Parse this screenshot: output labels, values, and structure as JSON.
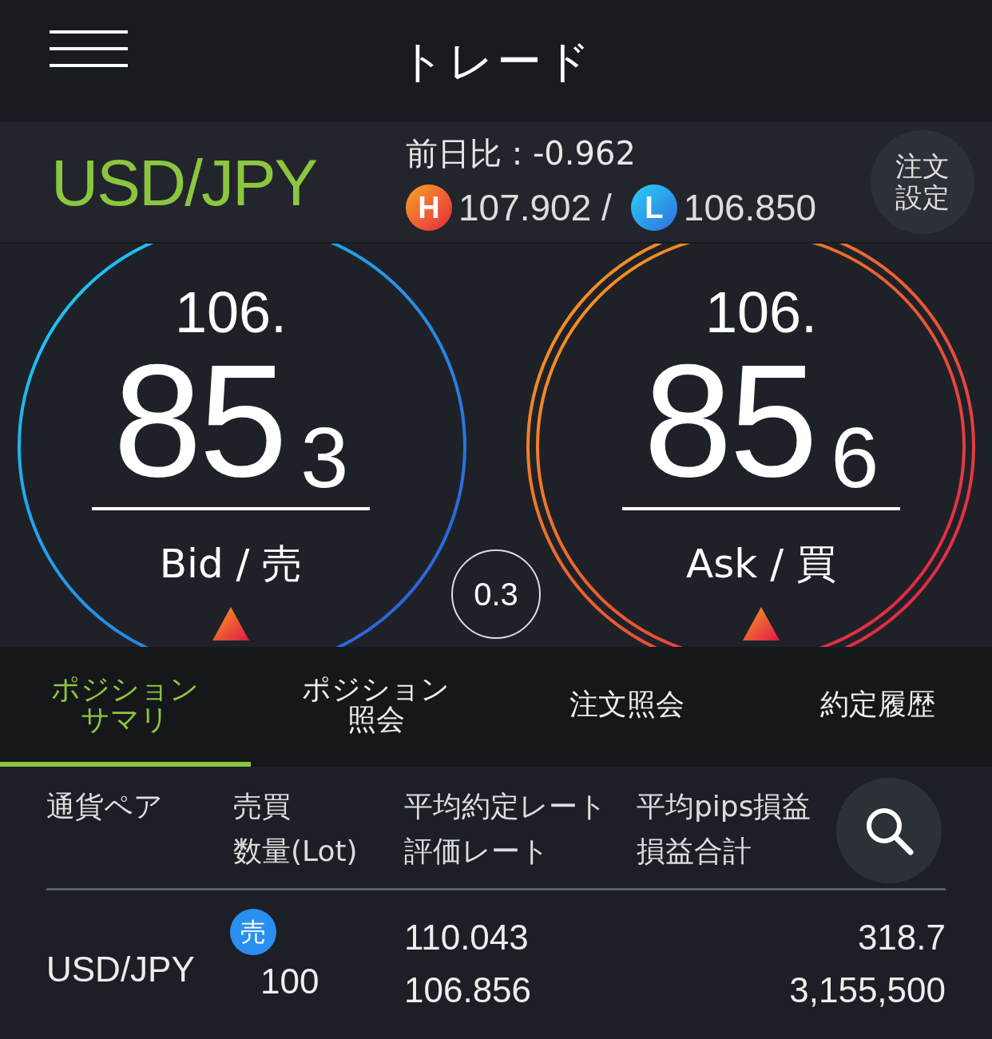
{
  "header": {
    "title": "トレード"
  },
  "pair": {
    "symbol": "USD/JPY",
    "change": "前日比 : -0.962",
    "high_badge": "H",
    "high": "107.902 /",
    "low_badge": "L",
    "low": "106.850",
    "order_settings": "注文設定"
  },
  "quotes": [
    {
      "kind": "bid",
      "head": "106.",
      "pips": "85",
      "fraction": "3",
      "label": "Bid / 売",
      "rising": true
    },
    {
      "kind": "ask",
      "head": "106.",
      "pips": "85",
      "fraction": "6",
      "label": "Ask / 買",
      "rising": true
    }
  ],
  "spread": "0.3",
  "tabs": [
    {
      "label": "ポジションサマリ",
      "selected": true
    },
    {
      "label": "ポジション照会",
      "selected": false
    },
    {
      "label": "注文照会",
      "selected": false
    },
    {
      "label": "約定履歴",
      "selected": false
    }
  ],
  "columns": [
    [
      "通貨ペア"
    ],
    [
      "売買",
      "数量(Lot)"
    ],
    [
      "平均約定レート",
      "評価レート"
    ],
    [
      "平均pips損益",
      "損益合計"
    ]
  ],
  "rows": [
    {
      "pair": "USD/JPY",
      "side": "売",
      "color": "#2a8ff0",
      "lot": "100",
      "avg_rate": "110.043",
      "eval_rate": "106.856",
      "avg_pips": "318.7",
      "total_pl": "3,155,500"
    }
  ]
}
